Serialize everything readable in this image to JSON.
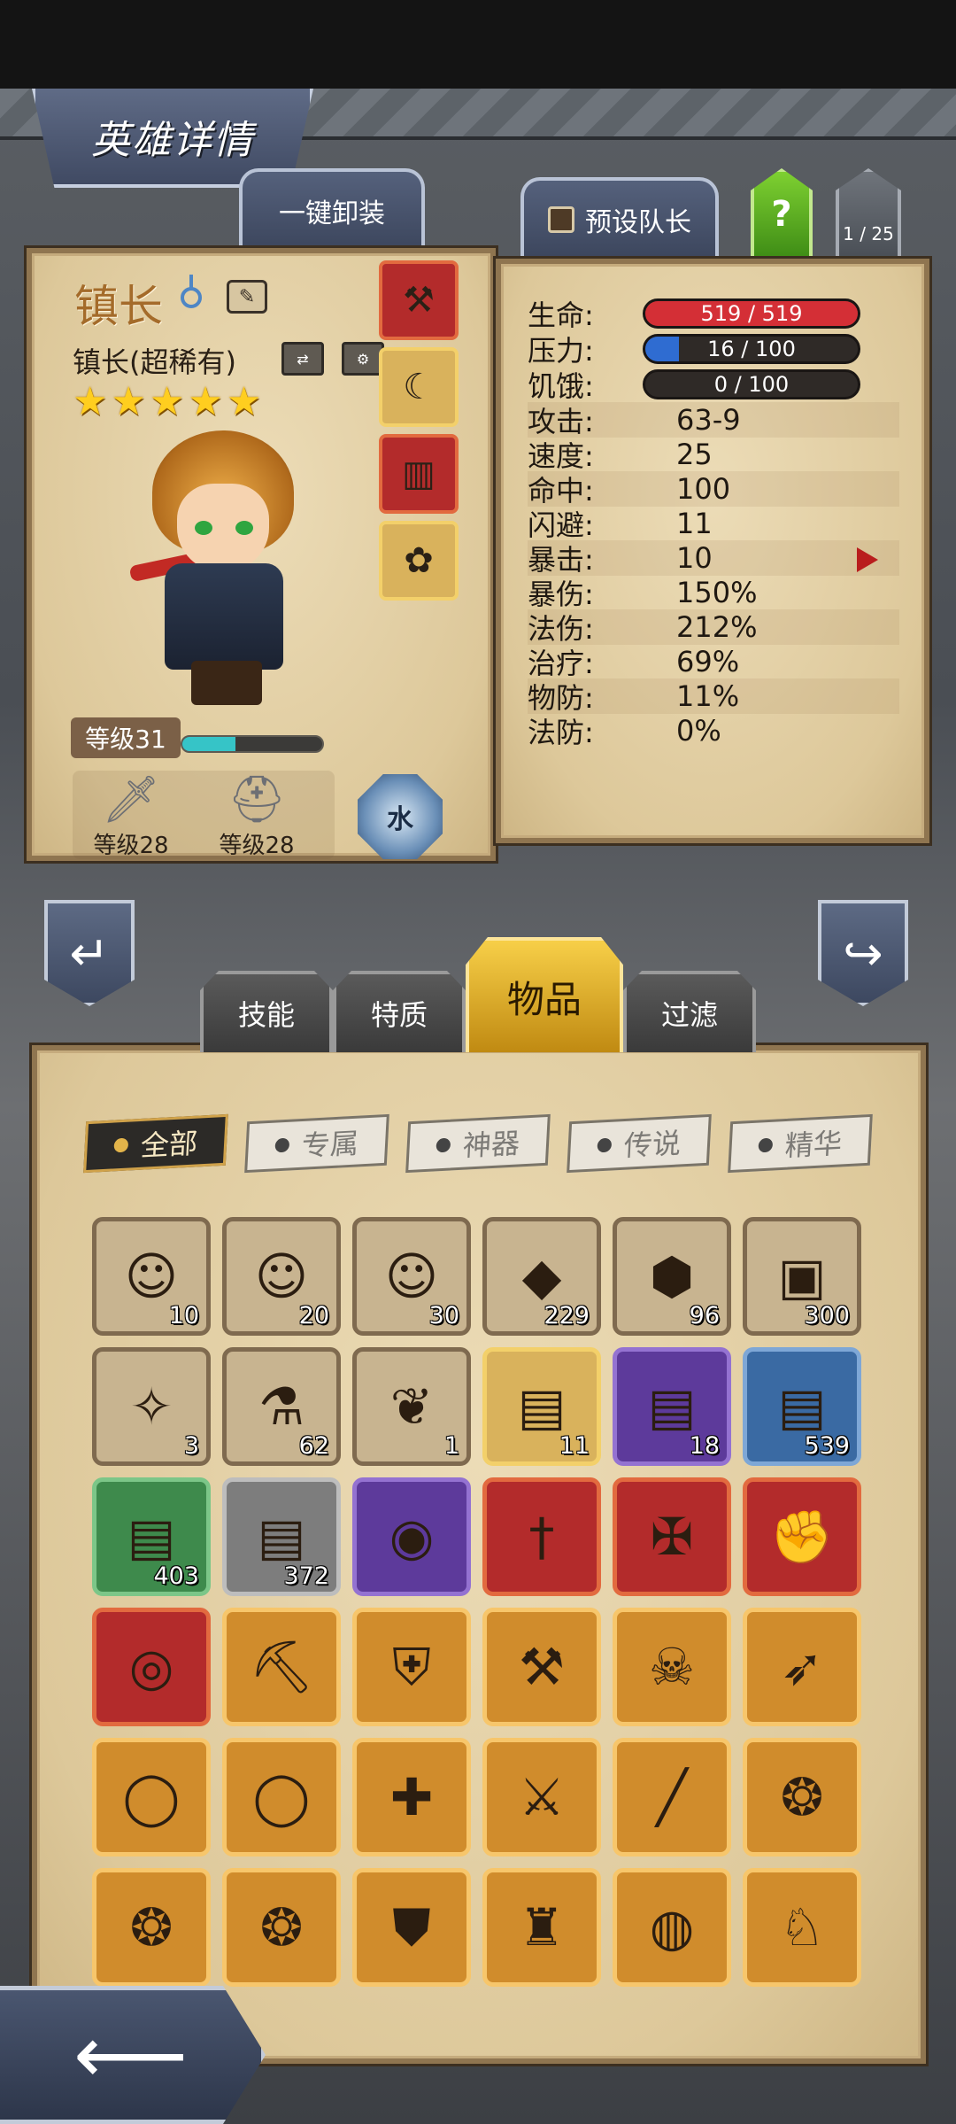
{
  "header": {
    "title": "英雄详情"
  },
  "top_actions": {
    "unequip_all": "一键卸装",
    "preset_leader": "预设队长",
    "help": "?",
    "page_counter": "1 / 25"
  },
  "hero": {
    "name": "镇长",
    "class_label": "镇长(超稀有)",
    "stars": [
      "★",
      "★",
      "★",
      "★",
      "★"
    ],
    "level_label": "等级31",
    "exp_progress": 0.38,
    "weapon_level": "等级28",
    "armor_level": "等级28",
    "element": "水",
    "equipment": [
      {
        "icon": "axe-icon",
        "quality": "red"
      },
      {
        "icon": "crescent-staff-icon",
        "quality": "gold"
      },
      {
        "icon": "red-book-icon",
        "quality": "red"
      },
      {
        "icon": "pouch-icon",
        "quality": "gold"
      }
    ]
  },
  "stats": {
    "life": {
      "label": "生命:",
      "value": "519 / 519",
      "fraction": 1.0,
      "color": "#d42f36"
    },
    "stress": {
      "label": "压力:",
      "value": "16 / 100",
      "fraction": 0.16,
      "color": "#2f6cd1"
    },
    "hunger": {
      "label": "饥饿:",
      "value": "0 / 100",
      "fraction": 0.0,
      "color": "#e0a020"
    },
    "rows": [
      {
        "label": "攻击:",
        "value": "63-9"
      },
      {
        "label": "速度:",
        "value": "25"
      },
      {
        "label": "命中:",
        "value": "100"
      },
      {
        "label": "闪避:",
        "value": "11"
      },
      {
        "label": "暴击:",
        "value": "10"
      },
      {
        "label": "暴伤:",
        "value": "150%"
      },
      {
        "label": "法伤:",
        "value": "212%"
      },
      {
        "label": "治疗:",
        "value": "69%"
      },
      {
        "label": "物防:",
        "value": "11%"
      },
      {
        "label": "法防:",
        "value": "0%"
      }
    ]
  },
  "tabs": {
    "skills": "技能",
    "traits": "特质",
    "items": "物品",
    "filter": "过滤"
  },
  "filters": {
    "all": "全部",
    "exclusive": "专属",
    "artifact": "神器",
    "legend": "传说",
    "essence": "精华"
  },
  "items": [
    {
      "icon": "hero-portrait-icon",
      "quality": "plain",
      "count": "10"
    },
    {
      "icon": "hero-portrait-icon",
      "quality": "plain",
      "count": "20"
    },
    {
      "icon": "hero-portrait-icon",
      "quality": "plain",
      "count": "30"
    },
    {
      "icon": "orange-gem-icon",
      "quality": "plain",
      "count": "229"
    },
    {
      "icon": "teal-rune-icon",
      "quality": "plain",
      "count": "96"
    },
    {
      "icon": "pink-chest-icon",
      "quality": "plain",
      "count": "300"
    },
    {
      "icon": "feather-charm-icon",
      "quality": "plain",
      "count": "3"
    },
    {
      "icon": "potion-icon",
      "quality": "plain",
      "count": "62"
    },
    {
      "icon": "feather-icon",
      "quality": "plain",
      "count": "1"
    },
    {
      "icon": "chest-icon",
      "quality": "gold",
      "count": "11"
    },
    {
      "icon": "chest-icon",
      "quality": "purple",
      "count": "18"
    },
    {
      "icon": "chest-icon",
      "quality": "blue",
      "count": "539"
    },
    {
      "icon": "chest-icon",
      "quality": "green",
      "count": "403"
    },
    {
      "icon": "chest-icon",
      "quality": "gray",
      "count": "372"
    },
    {
      "icon": "green-orb-icon",
      "quality": "purple",
      "count": ""
    },
    {
      "icon": "sword-icon",
      "quality": "red",
      "count": ""
    },
    {
      "icon": "crest-icon",
      "quality": "red",
      "count": ""
    },
    {
      "icon": "gauntlet-icon",
      "quality": "red",
      "count": ""
    },
    {
      "icon": "belt-icon",
      "quality": "red",
      "count": ""
    },
    {
      "icon": "pickaxe-icon",
      "quality": "orange",
      "count": ""
    },
    {
      "icon": "armor-icon",
      "quality": "orange",
      "count": ""
    },
    {
      "icon": "battle-axe-icon",
      "quality": "orange",
      "count": ""
    },
    {
      "icon": "skull-cloak-icon",
      "quality": "orange",
      "count": ""
    },
    {
      "icon": "spear-icon",
      "quality": "orange",
      "count": ""
    },
    {
      "icon": "ruby-ring-icon",
      "quality": "orange",
      "count": ""
    },
    {
      "icon": "ruby-ring-icon",
      "quality": "orange",
      "count": ""
    },
    {
      "icon": "medkit-icon",
      "quality": "orange",
      "count": ""
    },
    {
      "icon": "rapier-icon",
      "quality": "orange",
      "count": ""
    },
    {
      "icon": "staff-icon",
      "quality": "orange",
      "count": ""
    },
    {
      "icon": "winged-amulet-icon",
      "quality": "orange",
      "count": ""
    },
    {
      "icon": "winged-amulet-icon",
      "quality": "orange",
      "count": ""
    },
    {
      "icon": "winged-amulet-icon",
      "quality": "orange",
      "count": ""
    },
    {
      "icon": "shield-icon",
      "quality": "orange",
      "count": ""
    },
    {
      "icon": "hood-icon",
      "quality": "orange",
      "count": ""
    },
    {
      "icon": "jade-ring-icon",
      "quality": "orange",
      "count": ""
    },
    {
      "icon": "voodoo-doll-icon",
      "quality": "orange",
      "count": ""
    }
  ]
}
